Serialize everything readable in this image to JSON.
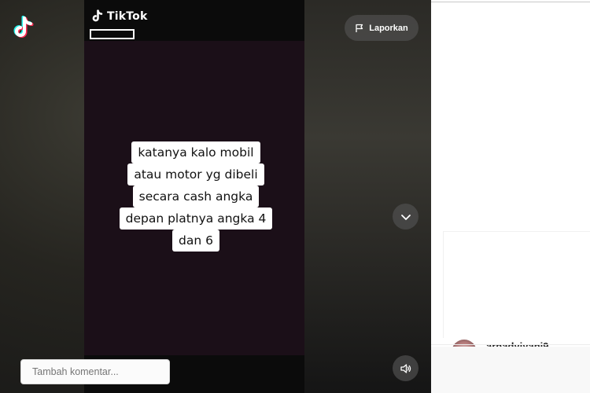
{
  "watermark": {
    "text": "TikTok"
  },
  "buttons": {
    "report_label": "Laporkan"
  },
  "caption": {
    "lines": [
      "katanya kalo mobil",
      "atau motor yg dibeli",
      "secara cash angka",
      "depan platnya angka 4",
      "dan 6"
    ]
  },
  "comments": {
    "partial_username": "arnadyiyani9"
  },
  "comment_input": {
    "placeholder": "Tambah komentar..."
  },
  "colors": {
    "brand_cyan": "#25F4EE",
    "brand_red": "#FE2C55",
    "overlay_button": "#5a5a5a"
  },
  "icons": {
    "app_logo": "tiktok-logo-icon",
    "watermark_logo": "tiktok-note-icon",
    "report": "flag-icon",
    "next": "chevron-down-icon",
    "volume": "speaker-icon"
  }
}
